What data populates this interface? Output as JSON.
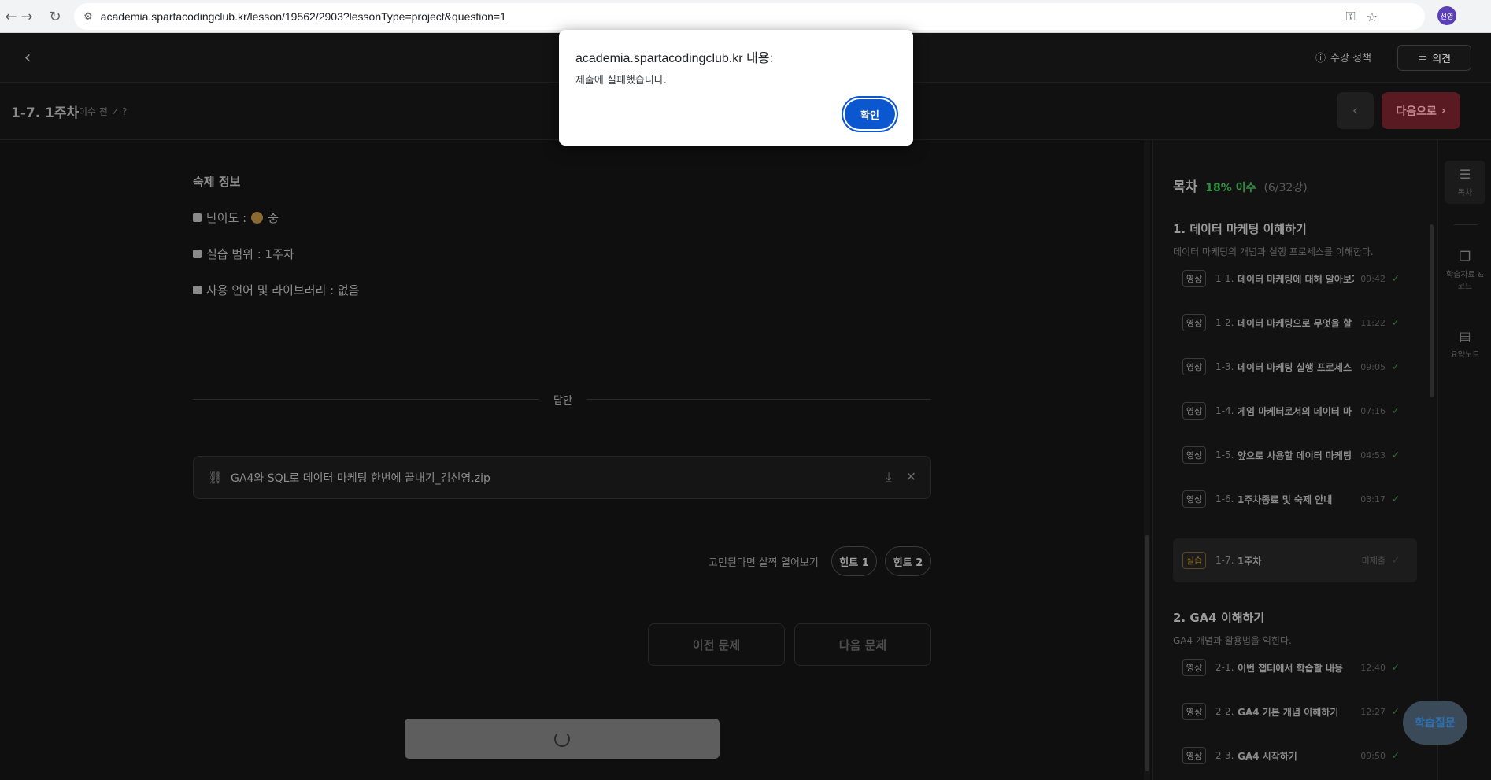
{
  "browser": {
    "url": "academia.spartacodingclub.kr/lesson/19562/2903?lessonType=project&question=1",
    "profile_label": "선영"
  },
  "header": {
    "policy_label": "수강 정책",
    "feedback_label": "의견"
  },
  "lesson": {
    "title": "1-7. 1주차",
    "status": "이수 전",
    "next_label": "다음으로"
  },
  "homework": {
    "title": "숙제 정보",
    "difficulty_label": "난이도 :",
    "difficulty_value": "중",
    "scope": "실습 범위 : 1주차",
    "language": "사용 언어 및 라이브러리 : 없음"
  },
  "answer": {
    "divider_label": "답안",
    "file_name": "GA4와 SQL로 데이터 마케팅 한번에 끝내기_김선영.zip"
  },
  "hints": {
    "prompt": "고민된다면 살짝 열어보기",
    "hint1": "힌트 1",
    "hint2": "힌트 2"
  },
  "questions": {
    "prev_label": "이전 문제",
    "next_label": "다음 문제"
  },
  "toc": {
    "title": "목차",
    "progress": "18% 이수",
    "count": "(6/32강)",
    "chapters": [
      {
        "title": "1. 데이터 마케팅 이해하기",
        "desc": "데이터 마케팅의 개념과 실행 프로세스를 이해한다.",
        "items": [
          {
            "badge": "영상",
            "num": "1-1.",
            "label": "데이터 마케팅에 대해 알아보기",
            "time": "09:42"
          },
          {
            "badge": "영상",
            "num": "1-2.",
            "label": "데이터 마케팅으로 무엇을 할",
            "time": "11:22"
          },
          {
            "badge": "영상",
            "num": "1-3.",
            "label": "데이터 마케팅 실행 프로세스",
            "time": "09:05"
          },
          {
            "badge": "영상",
            "num": "1-4.",
            "label": "게임 마케터로서의 데이터 마",
            "time": "07:16"
          },
          {
            "badge": "영상",
            "num": "1-5.",
            "label": "앞으로 사용할 데이터 마케팅",
            "time": "04:53"
          },
          {
            "badge": "영상",
            "num": "1-6.",
            "label": "1주차종료 및 숙제 안내",
            "time": "03:17"
          },
          {
            "badge": "실습",
            "num": "1-7.",
            "label": "1주차",
            "time": "미제출"
          }
        ]
      },
      {
        "title": "2. GA4 이해하기",
        "desc": "GA4 개념과 활용법을 익힌다.",
        "items": [
          {
            "badge": "영상",
            "num": "2-1.",
            "label": "이번 챕터에서 학습할 내용",
            "time": "12:40"
          },
          {
            "badge": "영상",
            "num": "2-2.",
            "label": "GA4 기본 개념 이해하기",
            "time": "12:27"
          },
          {
            "badge": "영상",
            "num": "2-3.",
            "label": "GA4 시작하기",
            "time": "09:50"
          }
        ]
      }
    ]
  },
  "rail": {
    "toc_label": "목차",
    "materials_label": "학습자료 & 코드",
    "notes_label": "요약노트"
  },
  "qa_label": "학습질문",
  "alert": {
    "title": "academia.spartacodingclub.kr 내용:",
    "message": "제출에 실패했습니다.",
    "ok_label": "확인"
  },
  "colors": {
    "accent_green": "#2f8f3f",
    "next_button": "#5a1a22",
    "alert_ok": "#0b57d0"
  }
}
